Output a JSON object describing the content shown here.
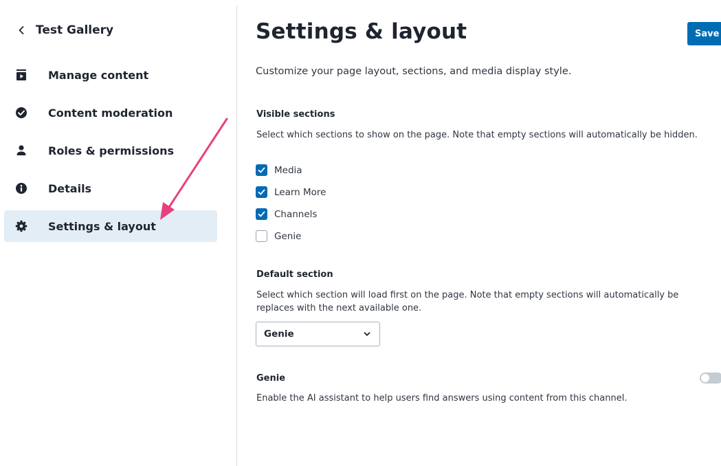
{
  "sidebar": {
    "back_title": "Test Gallery",
    "items": [
      {
        "label": "Manage content",
        "icon": "play-box-icon",
        "active": false
      },
      {
        "label": "Content moderation",
        "icon": "check-circle-icon",
        "active": false
      },
      {
        "label": "Roles & permissions",
        "icon": "person-icon",
        "active": false
      },
      {
        "label": "Details",
        "icon": "info-icon",
        "active": false
      },
      {
        "label": "Settings & layout",
        "icon": "gear-icon",
        "active": true
      }
    ]
  },
  "main": {
    "title": "Settings & layout",
    "save_label": "Save",
    "description": "Customize your page layout, sections, and media display style.",
    "visible_sections": {
      "heading": "Visible sections",
      "description": "Select which sections to show on the page. Note that empty sections will automatically be hidden.",
      "options": [
        {
          "label": "Media",
          "checked": true
        },
        {
          "label": "Learn More",
          "checked": true
        },
        {
          "label": "Channels",
          "checked": true
        },
        {
          "label": "Genie",
          "checked": false
        }
      ]
    },
    "default_section": {
      "heading": "Default section",
      "description": "Select which section will load first on the page. Note that empty sections will automatically be replaces with the next available one.",
      "selected": "Genie"
    },
    "genie": {
      "heading": "Genie",
      "description": "Enable the AI assistant to help users find answers using content from this channel.",
      "enabled": false
    }
  },
  "colors": {
    "accent": "#006cb4",
    "active_nav_bg": "#e3edf5",
    "annotation_arrow": "#e8407f"
  }
}
